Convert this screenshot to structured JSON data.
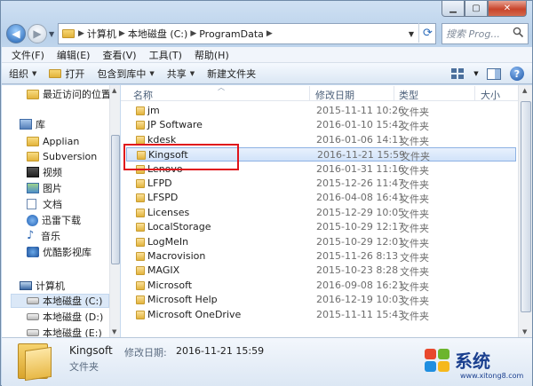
{
  "address": {
    "segments": [
      "计算机",
      "本地磁盘 (C:)",
      "ProgramData"
    ]
  },
  "search": {
    "placeholder": "搜索 Prog..."
  },
  "menu": [
    "文件(F)",
    "编辑(E)",
    "查看(V)",
    "工具(T)",
    "帮助(H)"
  ],
  "toolbar": {
    "organize": "组织",
    "open": "打开",
    "include_library": "包含到库中",
    "share": "共享",
    "new_folder": "新建文件夹"
  },
  "navpane": {
    "recent": "最近访问的位置",
    "libraries": "库",
    "lib_items": [
      "Applian",
      "Subversion",
      "视频",
      "图片",
      "文档",
      "迅雷下载",
      "音乐",
      "优酷影视库"
    ],
    "computer": "计算机",
    "drives": [
      "本地磁盘 (C:)",
      "本地磁盘 (D:)",
      "本地磁盘 (E:)"
    ]
  },
  "columns": {
    "name": "名称",
    "date": "修改日期",
    "type": "类型",
    "size": "大小"
  },
  "files": [
    {
      "name": "jm",
      "date": "2015-11-11 10:26",
      "type": "文件夹"
    },
    {
      "name": "JP Software",
      "date": "2016-01-10 15:42",
      "type": "文件夹"
    },
    {
      "name": "kdesk",
      "date": "2016-01-06 14:11",
      "type": "文件夹"
    },
    {
      "name": "Kingsoft",
      "date": "2016-11-21 15:59",
      "type": "文件夹"
    },
    {
      "name": "Lenovo",
      "date": "2016-01-31 11:16",
      "type": "文件夹"
    },
    {
      "name": "LFPD",
      "date": "2015-12-26 11:47",
      "type": "文件夹"
    },
    {
      "name": "LFSPD",
      "date": "2016-04-08 16:41",
      "type": "文件夹"
    },
    {
      "name": "Licenses",
      "date": "2015-12-29 10:05",
      "type": "文件夹"
    },
    {
      "name": "LocalStorage",
      "date": "2015-10-29 12:17",
      "type": "文件夹"
    },
    {
      "name": "LogMeIn",
      "date": "2015-10-29 12:01",
      "type": "文件夹"
    },
    {
      "name": "Macrovision",
      "date": "2015-11-26 8:13",
      "type": "文件夹"
    },
    {
      "name": "MAGIX",
      "date": "2015-10-23 8:28",
      "type": "文件夹"
    },
    {
      "name": "Microsoft",
      "date": "2016-09-08 16:21",
      "type": "文件夹"
    },
    {
      "name": "Microsoft Help",
      "date": "2016-12-19 10:03",
      "type": "文件夹"
    },
    {
      "name": "Microsoft OneDrive",
      "date": "2015-11-11 15:43",
      "type": "文件夹"
    }
  ],
  "selected_index": 3,
  "details": {
    "name": "Kingsoft",
    "date_label": "修改日期:",
    "date": "2016-11-21 15:59",
    "type": "文件夹"
  },
  "watermark": {
    "text": "系统",
    "url": "www.xitong8.com"
  }
}
